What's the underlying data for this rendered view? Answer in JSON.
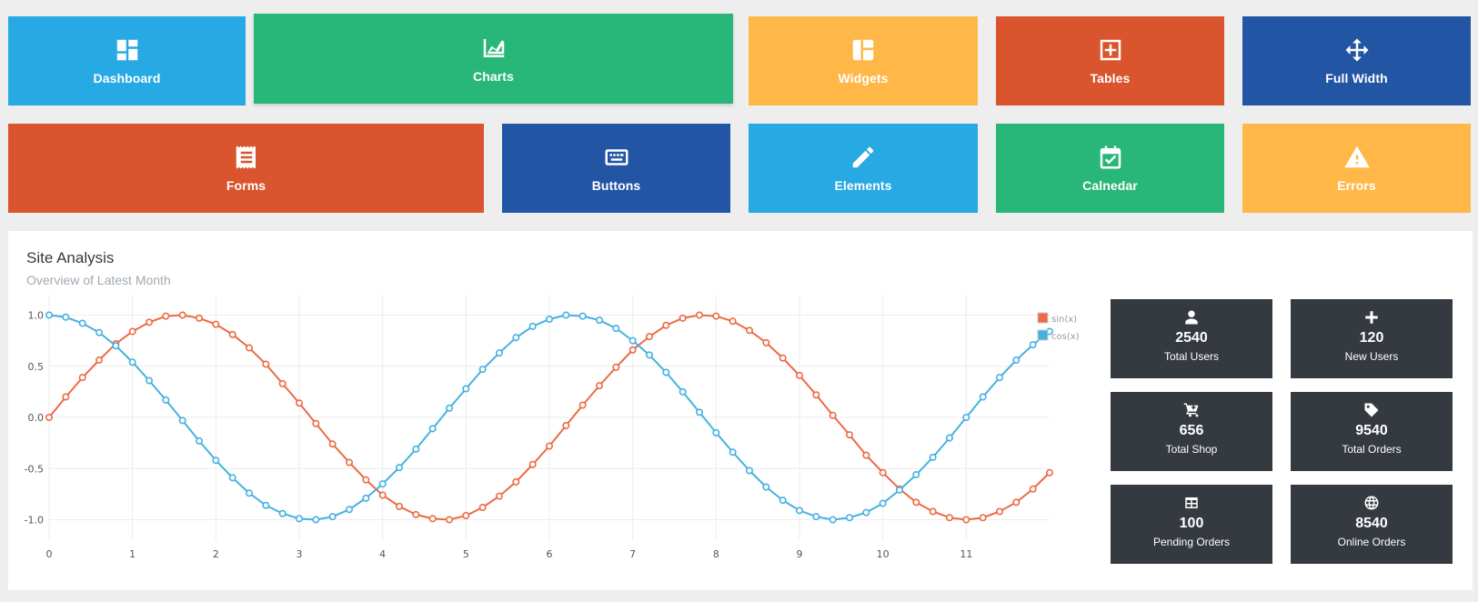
{
  "tiles": {
    "dashboard": {
      "label": "Dashboard",
      "color": "#27a9e3",
      "icon": "dashboard-icon"
    },
    "charts": {
      "label": "Charts",
      "color": "#28b779",
      "icon": "area-chart-icon"
    },
    "widgets": {
      "label": "Widgets",
      "color": "#ffb848",
      "icon": "collage-icon"
    },
    "tables": {
      "label": "Tables",
      "color": "#da542e",
      "icon": "border-inside-icon"
    },
    "fullwidth": {
      "label": "Full Width",
      "color": "#2255a4",
      "icon": "move-arrows-icon"
    },
    "forms": {
      "label": "Forms",
      "color": "#da542e",
      "icon": "receipt-icon"
    },
    "buttons": {
      "label": "Buttons",
      "color": "#2255a4",
      "icon": "keyboard-icon"
    },
    "elements": {
      "label": "Elements",
      "color": "#27a9e3",
      "icon": "pencil-icon"
    },
    "calendar": {
      "label": "Calnedar",
      "color": "#28b779",
      "icon": "calendar-check-icon"
    },
    "errors": {
      "label": "Errors",
      "color": "#ffb848",
      "icon": "alert-icon"
    }
  },
  "site_analysis": {
    "title": "Site Analysis",
    "subtitle": "Overview of Latest Month"
  },
  "stats": {
    "total_users": {
      "value": "2540",
      "label": "Total Users",
      "icon": "user-icon"
    },
    "new_users": {
      "value": "120",
      "label": "New Users",
      "icon": "plus-icon"
    },
    "total_shop": {
      "value": "656",
      "label": "Total Shop",
      "icon": "cart-plus-icon"
    },
    "total_orders": {
      "value": "9540",
      "label": "Total Orders",
      "icon": "tag-icon"
    },
    "pending_orders": {
      "value": "100",
      "label": "Pending Orders",
      "icon": "table-icon"
    },
    "online_orders": {
      "value": "8540",
      "label": "Online Orders",
      "icon": "globe-icon"
    }
  },
  "chart_data": {
    "type": "line",
    "title": "",
    "xlabel": "",
    "ylabel": "",
    "xlim": [
      0,
      12
    ],
    "ylim": [
      -1.2,
      1.2
    ],
    "x_ticks": [
      "0",
      "1",
      "2",
      "3",
      "4",
      "5",
      "6",
      "7",
      "8",
      "9",
      "10",
      "11"
    ],
    "y_ticks": [
      "1.0",
      "0.5",
      "0.0",
      "-0.5",
      "-1.0"
    ],
    "grid": true,
    "legend_position": "top-right",
    "x": [
      0,
      0.2,
      0.4,
      0.6,
      0.8,
      1.0,
      1.2,
      1.4,
      1.6,
      1.8,
      2.0,
      2.2,
      2.4,
      2.6,
      2.8,
      3.0,
      3.2,
      3.4,
      3.6,
      3.8,
      4.0,
      4.2,
      4.4,
      4.6,
      4.8,
      5.0,
      5.2,
      5.4,
      5.6,
      5.8,
      6.0,
      6.2,
      6.4,
      6.6,
      6.8,
      7.0,
      7.2,
      7.4,
      7.6,
      7.8,
      8.0,
      8.2,
      8.4,
      8.6,
      8.8,
      9.0,
      9.2,
      9.4,
      9.6,
      9.8,
      10.0,
      10.2,
      10.4,
      10.6,
      10.8,
      11.0,
      11.2,
      11.4,
      11.6,
      11.8,
      12.0
    ],
    "series": [
      {
        "name": "sin(x)",
        "color": "#ed6a44",
        "values": [
          0,
          0.2,
          0.39,
          0.56,
          0.72,
          0.84,
          0.93,
          0.99,
          1.0,
          0.97,
          0.91,
          0.81,
          0.68,
          0.52,
          0.33,
          0.14,
          -0.06,
          -0.26,
          -0.44,
          -0.61,
          -0.76,
          -0.87,
          -0.95,
          -0.99,
          -1.0,
          -0.96,
          -0.88,
          -0.77,
          -0.63,
          -0.46,
          -0.28,
          -0.08,
          0.12,
          0.31,
          0.49,
          0.66,
          0.79,
          0.9,
          0.97,
          1.0,
          0.99,
          0.94,
          0.85,
          0.73,
          0.58,
          0.41,
          0.22,
          0.02,
          -0.17,
          -0.37,
          -0.54,
          -0.7,
          -0.83,
          -0.92,
          -0.98,
          -1.0,
          -0.98,
          -0.92,
          -0.83,
          -0.7,
          -0.54
        ]
      },
      {
        "name": "cos(x)",
        "color": "#46b1e0",
        "values": [
          1.0,
          0.98,
          0.92,
          0.83,
          0.7,
          0.54,
          0.36,
          0.17,
          -0.03,
          -0.23,
          -0.42,
          -0.59,
          -0.74,
          -0.86,
          -0.94,
          -0.99,
          -1.0,
          -0.97,
          -0.9,
          -0.79,
          -0.65,
          -0.49,
          -0.31,
          -0.11,
          0.09,
          0.28,
          0.47,
          0.63,
          0.78,
          0.89,
          0.96,
          1.0,
          0.99,
          0.95,
          0.87,
          0.75,
          0.61,
          0.44,
          0.25,
          0.05,
          -0.15,
          -0.34,
          -0.52,
          -0.68,
          -0.81,
          -0.91,
          -0.97,
          -1.0,
          -0.98,
          -0.93,
          -0.84,
          -0.71,
          -0.56,
          -0.39,
          -0.2,
          0.0,
          0.2,
          0.39,
          0.56,
          0.71,
          0.84
        ]
      }
    ]
  }
}
